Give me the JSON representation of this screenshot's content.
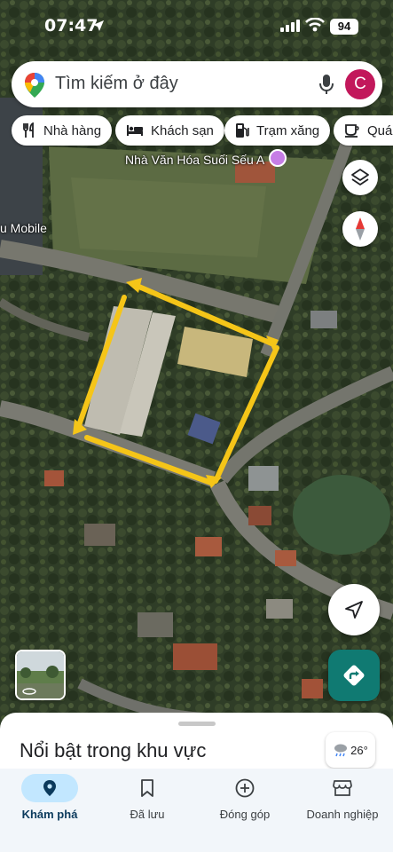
{
  "status_bar": {
    "time": "07:47",
    "battery": "94"
  },
  "search": {
    "placeholder": "Tìm kiếm ở đây",
    "avatar_letter": "C"
  },
  "chips": [
    {
      "icon": "restaurant-icon",
      "label": "Nhà hàng"
    },
    {
      "icon": "hotel-icon",
      "label": "Khách sạn"
    },
    {
      "icon": "gas-station-icon",
      "label": "Trạm xăng"
    },
    {
      "icon": "cafe-icon",
      "label": "Quán"
    }
  ],
  "map": {
    "labels": {
      "poi": "Nhà Văn Hóa Suối Sếu A",
      "store": "u Mobile"
    },
    "highlight_color": "#f5c518"
  },
  "sheet": {
    "title": "Nổi bật trong khu vực",
    "temperature": "26°"
  },
  "nav": [
    {
      "icon": "explore-pin-icon",
      "label": "Khám phá",
      "active": true
    },
    {
      "icon": "bookmark-icon",
      "label": "Đã lưu",
      "active": false
    },
    {
      "icon": "add-circle-icon",
      "label": "Đóng góp",
      "active": false
    },
    {
      "icon": "business-icon",
      "label": "Doanh nghiệp",
      "active": false
    }
  ],
  "colors": {
    "accent": "#107a72",
    "avatar": "#c2185b",
    "nav_active": "#c2e7ff"
  }
}
